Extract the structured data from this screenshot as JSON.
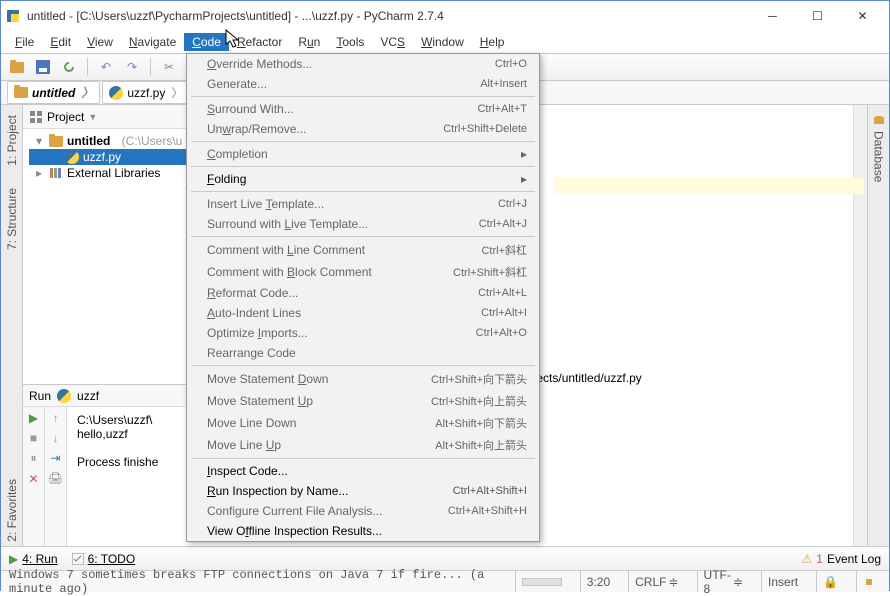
{
  "window": {
    "title": "untitled - [C:\\Users\\uzzf\\PycharmProjects\\untitled] - ...\\uzzf.py - PyCharm 2.7.4"
  },
  "menubar": {
    "items": [
      {
        "label": "File",
        "u": 0
      },
      {
        "label": "Edit",
        "u": 0
      },
      {
        "label": "View",
        "u": 0
      },
      {
        "label": "Navigate",
        "u": 0
      },
      {
        "label": "Code",
        "u": 0
      },
      {
        "label": "Refactor",
        "u": 0
      },
      {
        "label": "Run",
        "u": 1
      },
      {
        "label": "Tools",
        "u": 0
      },
      {
        "label": "VCS",
        "u": 2
      },
      {
        "label": "Window",
        "u": 0
      },
      {
        "label": "Help",
        "u": 0
      }
    ],
    "active": 4
  },
  "crumbs": {
    "a": "untitled",
    "b": "uzzf.py"
  },
  "project": {
    "header": "Project",
    "root_name": "untitled",
    "root_path": "(C:\\Users\\u",
    "file": "uzzf.py",
    "ext": "External Libraries"
  },
  "code_menu": [
    {
      "label": "Override Methods...",
      "u": 0,
      "sc": "Ctrl+O",
      "en": false
    },
    {
      "label": "Generate...",
      "u": -1,
      "sc": "Alt+Insert",
      "en": false
    },
    {
      "sep": true
    },
    {
      "label": "Surround With...",
      "u": 0,
      "sc": "Ctrl+Alt+T",
      "en": false
    },
    {
      "label": "Unwrap/Remove...",
      "u": 2,
      "sc": "Ctrl+Shift+Delete",
      "en": false
    },
    {
      "sep": true
    },
    {
      "label": "Completion",
      "u": 0,
      "sc": "",
      "en": false,
      "sub": true
    },
    {
      "sep": true
    },
    {
      "label": "Folding",
      "u": 0,
      "sc": "",
      "en": true,
      "sub": true
    },
    {
      "sep": true
    },
    {
      "label": "Insert Live Template...",
      "u": 12,
      "sc": "Ctrl+J",
      "en": false
    },
    {
      "label": "Surround with Live Template...",
      "u": 14,
      "sc": "Ctrl+Alt+J",
      "en": false
    },
    {
      "sep": true
    },
    {
      "label": "Comment with Line Comment",
      "u": 13,
      "sc": "Ctrl+斜杠",
      "en": false
    },
    {
      "label": "Comment with Block Comment",
      "u": 13,
      "sc": "Ctrl+Shift+斜杠",
      "en": false
    },
    {
      "label": "Reformat Code...",
      "u": 0,
      "sc": "Ctrl+Alt+L",
      "en": false
    },
    {
      "label": "Auto-Indent Lines",
      "u": 0,
      "sc": "Ctrl+Alt+I",
      "en": false
    },
    {
      "label": "Optimize Imports...",
      "u": 9,
      "sc": "Ctrl+Alt+O",
      "en": false
    },
    {
      "label": "Rearrange Code",
      "u": -1,
      "sc": "",
      "en": false
    },
    {
      "sep": true
    },
    {
      "label": "Move Statement Down",
      "u": 15,
      "sc": "Ctrl+Shift+向下箭头",
      "en": false
    },
    {
      "label": "Move Statement Up",
      "u": 15,
      "sc": "Ctrl+Shift+向上箭头",
      "en": false
    },
    {
      "label": "Move Line Down",
      "u": -1,
      "sc": "Alt+Shift+向下箭头",
      "en": false
    },
    {
      "label": "Move Line Up",
      "u": 10,
      "sc": "Alt+Shift+向上箭头",
      "en": false
    },
    {
      "sep": true
    },
    {
      "label": "Inspect Code...",
      "u": 0,
      "sc": "",
      "en": true
    },
    {
      "label": "Run Inspection by Name...",
      "u": 0,
      "sc": "Ctrl+Alt+Shift+I",
      "en": true
    },
    {
      "label": "Configure Current File Analysis...",
      "u": -1,
      "sc": "Ctrl+Alt+Shift+H",
      "en": false
    },
    {
      "label": "View Offline Inspection Results...",
      "u": 6,
      "sc": "",
      "en": true
    }
  ],
  "run": {
    "label": "Run",
    "config": "uzzf",
    "path": "zf/PycharmProjects/untitled/uzzf.py",
    "path_prefix": "C:\\Users\\uzzf\\",
    "out": "hello,uzzf",
    "exit": "Process finishe"
  },
  "bottom": {
    "run": "4: Run",
    "todo": "6: TODO",
    "eventlog": "Event Log"
  },
  "status": {
    "msg": "Windows 7 sometimes breaks FTP connections on Java 7 if fire... (a minute ago)",
    "pos": "3:20",
    "eol": "CRLF",
    "enc": "UTF-8",
    "ins": "Insert"
  },
  "left_tabs": {
    "project": "1: Project",
    "structure": "7: Structure",
    "favorites": "2: Favorites"
  },
  "right_tabs": {
    "database": "Database"
  }
}
